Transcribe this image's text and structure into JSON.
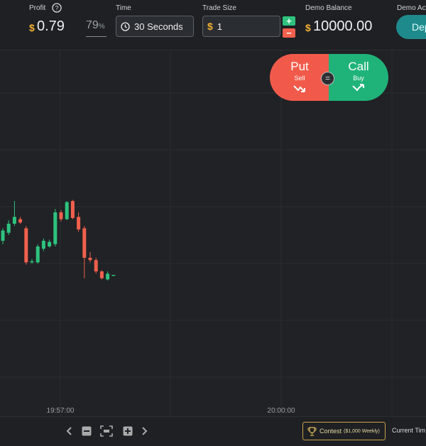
{
  "header": {
    "profit_label": "Profit",
    "currency_symbol": "$",
    "profit_value": "0.79",
    "payout_value": "79",
    "payout_unit": "%",
    "time_label": "Time",
    "time_value": "30 Seconds",
    "trade_size_label": "Trade Size",
    "trade_size_value": "1",
    "plus_label": "+",
    "minus_label": "−",
    "balance_label": "Demo Balance",
    "balance_value": "10000.00",
    "account_label": "Demo Ac",
    "deposit_label": "Dep"
  },
  "trade": {
    "put_label": "Put",
    "put_sub": "Sell",
    "call_label": "Call",
    "call_sub": "Buy",
    "equal_label": "="
  },
  "chart_data": {
    "type": "candlestick",
    "x_tick_labels": [
      "19:57:00",
      "20:00:00"
    ],
    "candles": [
      {
        "o": 45,
        "c": 54,
        "h": 56,
        "l": 42
      },
      {
        "o": 52,
        "c": 60,
        "h": 63,
        "l": 50
      },
      {
        "o": 60,
        "c": 66,
        "h": 80,
        "l": 58
      },
      {
        "o": 64,
        "c": 61,
        "h": 66,
        "l": 60
      },
      {
        "o": 56,
        "c": 26,
        "h": 58,
        "l": 24
      },
      {
        "o": 26,
        "c": 27,
        "h": 29,
        "l": 25
      },
      {
        "o": 26,
        "c": 40,
        "h": 42,
        "l": 25
      },
      {
        "o": 38,
        "c": 45,
        "h": 47,
        "l": 36
      },
      {
        "o": 40,
        "c": 44,
        "h": 46,
        "l": 39
      },
      {
        "o": 42,
        "c": 70,
        "h": 73,
        "l": 40
      },
      {
        "o": 70,
        "c": 64,
        "h": 72,
        "l": 62
      },
      {
        "o": 64,
        "c": 79,
        "h": 80,
        "l": 63
      },
      {
        "o": 80,
        "c": 65,
        "h": 81,
        "l": 64
      },
      {
        "o": 66,
        "c": 55,
        "h": 70,
        "l": 53
      },
      {
        "o": 56,
        "c": 30,
        "h": 58,
        "l": 12
      },
      {
        "o": 30,
        "c": 28,
        "h": 35,
        "l": 26
      },
      {
        "o": 28,
        "c": 18,
        "h": 30,
        "l": 16
      },
      {
        "o": 18,
        "c": 12,
        "h": 19,
        "l": 11
      },
      {
        "o": 11,
        "c": 16,
        "h": 18,
        "l": 10
      },
      {
        "o": 15,
        "c": 15,
        "h": 15,
        "l": 15
      }
    ],
    "colors": {
      "up": "#2ec27e",
      "down": "#f0604d"
    }
  },
  "footer": {
    "contest_label": "Contest",
    "contest_sub": "($1,000 Weekly)",
    "current_time_label": "Current Tim"
  }
}
